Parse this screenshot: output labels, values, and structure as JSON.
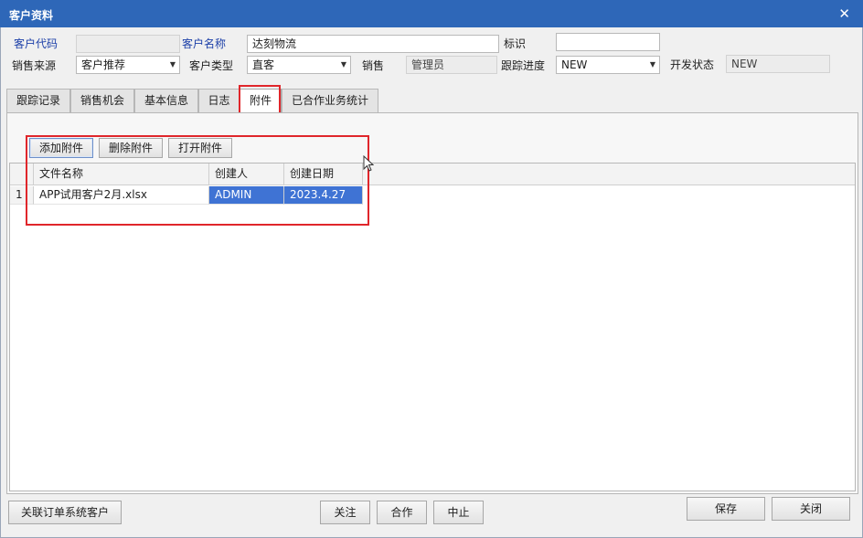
{
  "window": {
    "title": "客户资料",
    "close": "✕"
  },
  "form": {
    "customer_code_label": "客户代码",
    "customer_code_value": "",
    "customer_name_label": "客户名称",
    "customer_name_value": "达刻物流",
    "tag_label": "标识",
    "tag_value": "",
    "source_label": "销售来源",
    "source_value": "客户推荐",
    "customer_type_label": "客户类型",
    "customer_type_value": "直客",
    "sales_label": "销售",
    "sales_value": "管理员",
    "progress_label": "跟踪进度",
    "progress_value": "NEW",
    "dev_status_label": "开发状态",
    "dev_status_value": "NEW"
  },
  "tabs": [
    "跟踪记录",
    "销售机会",
    "基本信息",
    "日志",
    "附件",
    "已合作业务统计"
  ],
  "active_tab": "附件",
  "attachments": {
    "add_label": "添加附件",
    "delete_label": "删除附件",
    "open_label": "打开附件",
    "columns": [
      "文件名称",
      "创建人",
      "创建日期"
    ],
    "rows": [
      {
        "index": "1",
        "file_name": "APP试用客户2月.xlsx",
        "creator": "ADMIN",
        "date": "2023.4.27"
      }
    ]
  },
  "footer": {
    "link_customer_label": "关联订单系统客户",
    "follow_label": "关注",
    "cooperate_label": "合作",
    "stop_label": "中止",
    "save_label": "保存",
    "close_label": "关闭"
  }
}
